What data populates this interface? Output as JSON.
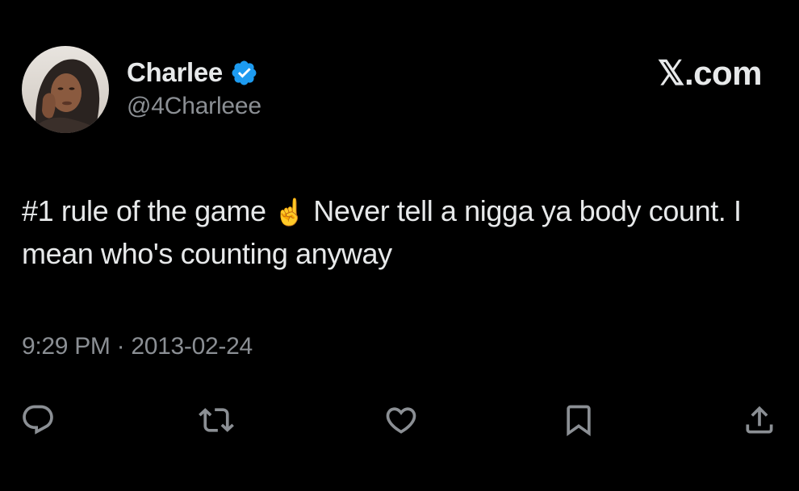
{
  "tweet": {
    "author": {
      "display_name": "Charlee",
      "handle": "@4Charleee",
      "verified": true,
      "verified_color": "#1d9bf0"
    },
    "brand": "𝕏.com",
    "text_before_emoji": "#1 rule of the game ",
    "emoji": "☝️",
    "text_after_emoji": " Never tell a nigga ya body count. I mean who's counting anyway",
    "timestamp": "9:29 PM · 2013-02-24"
  },
  "actions": {
    "icons": [
      "reply-icon",
      "retweet-icon",
      "like-icon",
      "bookmark-icon",
      "share-icon"
    ],
    "icon_color": "#8b8f94"
  },
  "colors": {
    "background": "#000000",
    "primary_text": "#e7e9ea",
    "secondary_text": "#8b8f94"
  }
}
